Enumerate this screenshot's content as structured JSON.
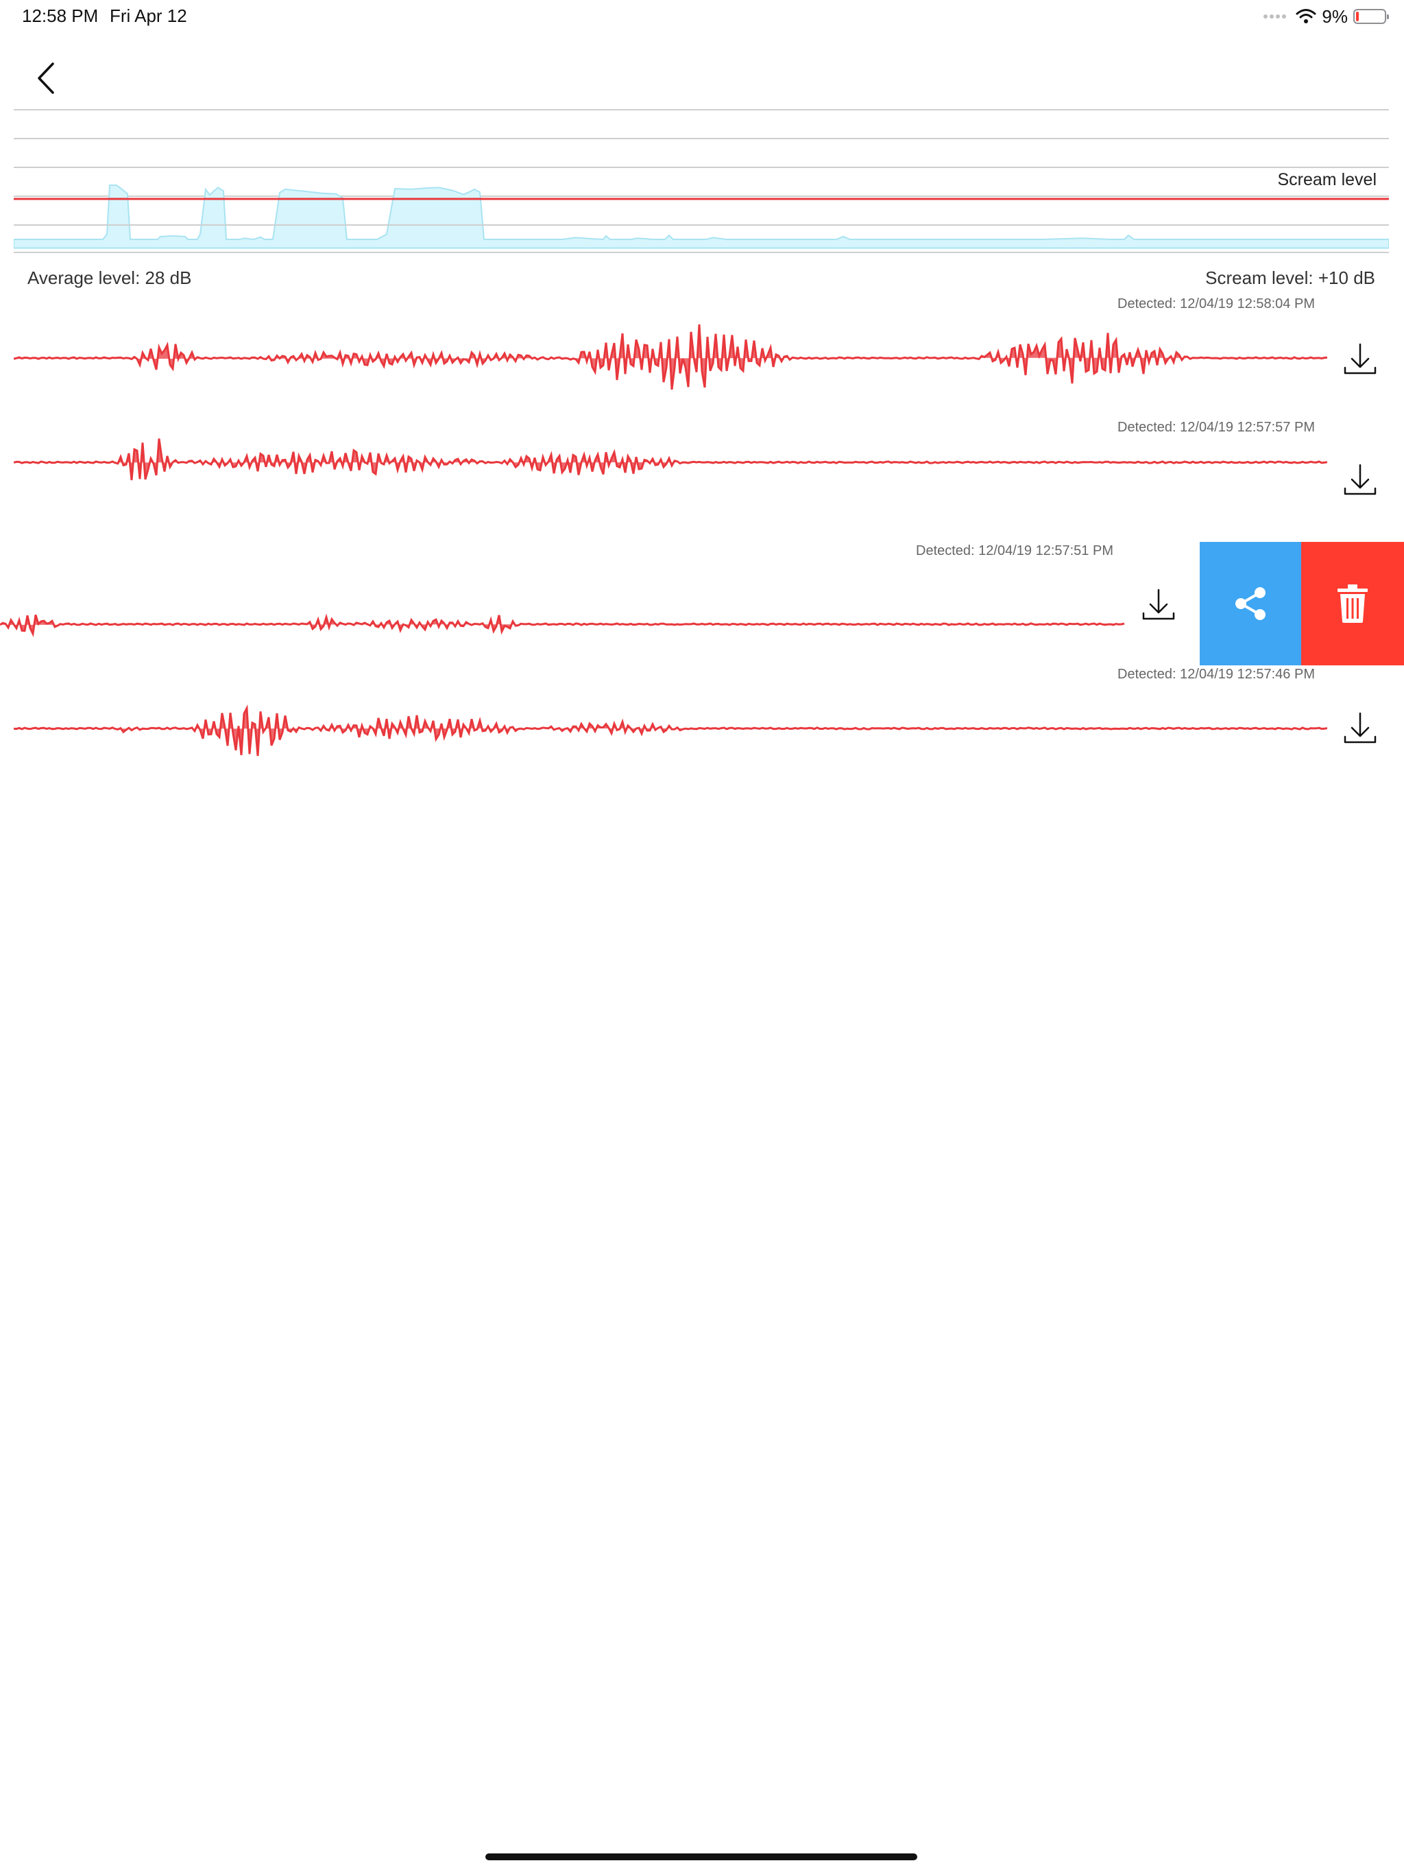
{
  "status_bar": {
    "time": "12:58 PM",
    "date": "Fri Apr 12",
    "battery_percent": "9%",
    "battery_level": 0.09,
    "icons": [
      "cellular-dots-icon",
      "wifi-icon",
      "battery-icon"
    ]
  },
  "nav": {
    "back_icon": "chevron-left-icon"
  },
  "overview": {
    "scream_level_label": "Scream level",
    "colors": {
      "fill": "#d6f5fc",
      "stroke": "#a9e3f2",
      "threshold": "#e8383d",
      "grid": "#cfcfcf"
    }
  },
  "summary": {
    "average_level": "Average level: 28 dB",
    "scream_level": "Scream level: +10 dB"
  },
  "recordings": [
    {
      "detected": "Detected: 12/04/19 12:58:04 PM",
      "download_icon": "download-icon"
    },
    {
      "detected": "Detected: 12/04/19 12:57:57 PM",
      "download_icon": "download-icon"
    },
    {
      "detected": "Detected: 12/04/19 12:57:51 PM",
      "download_icon": "download-icon",
      "swiped": true
    },
    {
      "detected": "Detected: 12/04/19 12:57:46 PM",
      "download_icon": "download-icon"
    }
  ],
  "swipe_actions": {
    "share_icon": "share-icon",
    "delete_icon": "trash-icon",
    "colors": {
      "share": "#3ea6f2",
      "delete": "#ff3b30"
    }
  },
  "waveform_color": "#e8383d"
}
